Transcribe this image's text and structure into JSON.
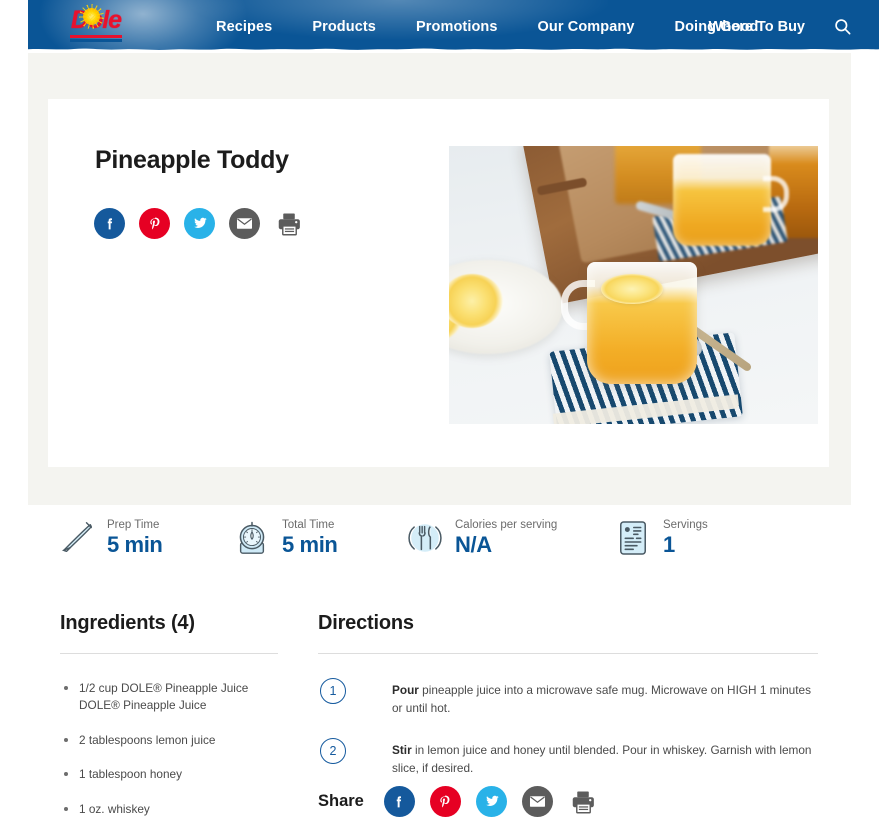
{
  "nav": {
    "brand": "Dole",
    "brand_logo_icon": "dole-sunburst-logo",
    "links": [
      {
        "label": "Recipes"
      },
      {
        "label": "Products"
      },
      {
        "label": "Promotions"
      },
      {
        "label": "Our Company"
      },
      {
        "label": "Doing Good"
      }
    ],
    "where_to_buy": "Where To Buy",
    "search_icon": "search-icon"
  },
  "recipe": {
    "title": "Pineapple Toddy",
    "hero_image_alt": "Pineapple toddy in a glass mug with lemon slice on a blue striped napkin"
  },
  "share": {
    "label": "Share",
    "buttons": [
      {
        "name": "facebook",
        "icon": "facebook-icon",
        "color": "#15599c"
      },
      {
        "name": "pinterest",
        "icon": "pinterest-icon",
        "color": "#e60023"
      },
      {
        "name": "twitter",
        "icon": "twitter-icon",
        "color": "#29b2e8"
      },
      {
        "name": "email",
        "icon": "email-icon",
        "color": "#5c5c5c"
      },
      {
        "name": "print",
        "icon": "printer-icon",
        "color": "#5c5c5c"
      }
    ]
  },
  "stats": [
    {
      "icon": "knife-icon",
      "label": "Prep Time",
      "value": "5 min"
    },
    {
      "icon": "timer-icon",
      "label": "Total Time",
      "value": "5 min"
    },
    {
      "icon": "fork-knife-plate-icon",
      "label": "Calories per serving",
      "value": "N/A"
    },
    {
      "icon": "recipe-card-icon",
      "label": "Servings",
      "value": "1"
    }
  ],
  "ingredients": {
    "heading": "Ingredients (4)",
    "count": 4,
    "items": [
      "1/2 cup DOLE® Pineapple Juice DOLE® Pineapple Juice",
      "2 tablespoons lemon juice",
      "1 tablespoon honey",
      "1 oz. whiskey"
    ]
  },
  "directions": {
    "heading": "Directions",
    "steps": [
      {
        "number": "1",
        "lead": "Pour",
        "text": " pineapple juice into a microwave safe mug. Microwave on HIGH 1 minutes or until hot."
      },
      {
        "number": "2",
        "lead": "Stir",
        "text": " in lemon juice and honey until blended. Pour in whiskey. Garnish with lemon slice, if desired."
      }
    ]
  },
  "colors": {
    "nav_blue": "#0a5596",
    "accent_blue": "#155a9e",
    "page_bg": "#f4f4f0",
    "card_bg": "#ffffff",
    "brand_red": "#e8112d",
    "brand_yellow": "#ffd400"
  }
}
